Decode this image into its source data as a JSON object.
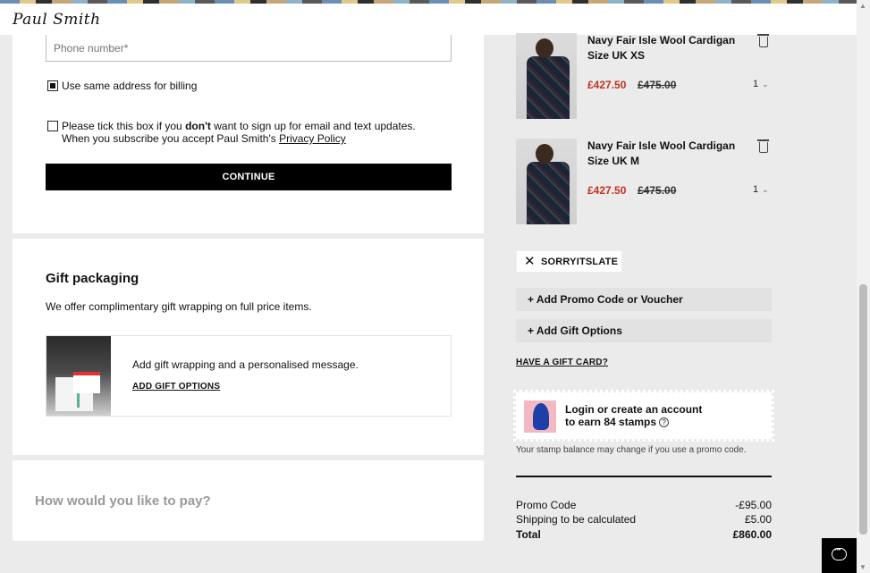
{
  "header": {
    "logo_text": "Paul Smith"
  },
  "form": {
    "phone_placeholder": "Phone number*",
    "billing_label": "Use same address for billing",
    "billing_checked": true,
    "optout_text_before": "Please tick this box if you ",
    "optout_text_bold": "don't",
    "optout_text_after": " want to sign up for email and text updates. When you subscribe you accept Paul Smith's ",
    "optout_link": "Privacy Policy",
    "optout_checked": false,
    "continue_label": "CONTINUE"
  },
  "gift_packaging": {
    "title": "Gift packaging",
    "description": "We offer complimentary gift wrapping on full price items.",
    "message": "Add gift wrapping and a personalised message.",
    "link": "ADD GIFT OPTIONS"
  },
  "payment": {
    "heading": "How would you like to pay?"
  },
  "cart": {
    "items": [
      {
        "name": "Navy Fair Isle Wool Cardigan",
        "size": "Size UK XS",
        "sale_price": "£427.50",
        "original_price": "£475.00",
        "quantity": "1"
      },
      {
        "name": "Navy Fair Isle Wool Cardigan",
        "size": "Size UK M",
        "sale_price": "£427.50",
        "original_price": "£475.00",
        "quantity": "1"
      }
    ],
    "applied_promo": "SORRYITSLATE",
    "add_promo_label": "+ Add Promo Code or Voucher",
    "add_gift_label": "+ Add Gift Options",
    "gift_card_link": "HAVE A GIFT CARD?",
    "stamps": {
      "line1": "Login or create an account",
      "line2": "to earn 84 stamps",
      "note": "Your stamp balance may change if you use a promo code."
    },
    "summary": [
      {
        "label": "Promo Code",
        "value": "-£95.00"
      },
      {
        "label": "Shipping to be calculated",
        "value": "£5.00"
      },
      {
        "label": "Total",
        "value": "£860.00"
      }
    ]
  },
  "colors": {
    "sale": "#c2301f",
    "button": "#000000",
    "page_bg": "#ebebeb"
  },
  "icons": [
    "trash-icon",
    "close-icon",
    "chevron-down-icon",
    "help-icon",
    "chat-icon"
  ]
}
